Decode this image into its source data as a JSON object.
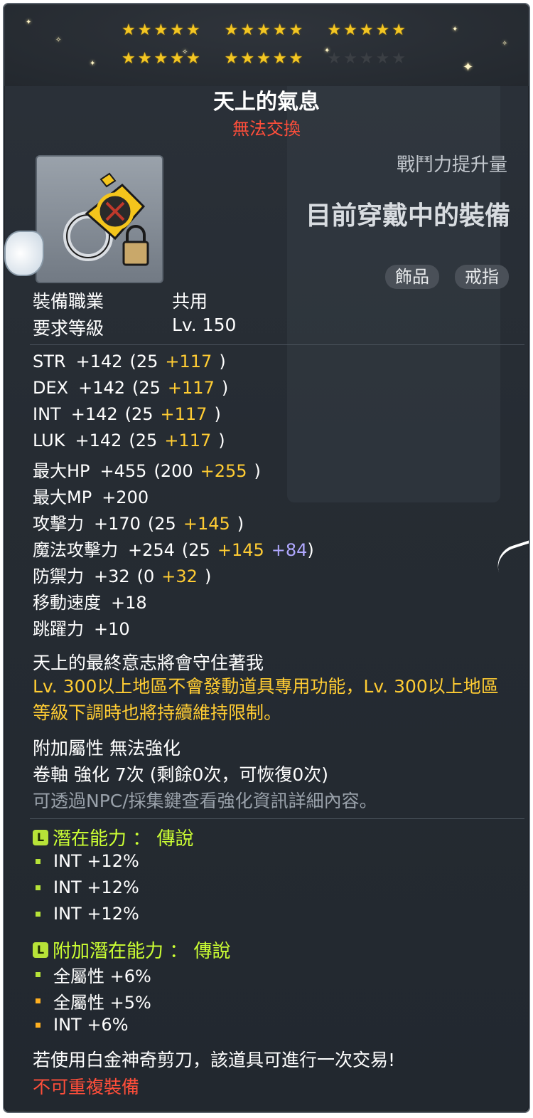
{
  "colors": {
    "accent_gold": "#ffcc33",
    "accent_blue": "#b0a8ff",
    "warning_red": "#ff4e3a",
    "potential_green": "#ccff33"
  },
  "stars": {
    "filled": 25,
    "total": 30
  },
  "item": {
    "name": "天上的氣息",
    "trade_status": "無法交換",
    "icon": "gold-ring-lock-icon"
  },
  "combat_power": {
    "label": "戰鬥力提升量",
    "value": "目前穿戴中的裝備"
  },
  "tags": {
    "category": "飾品",
    "type": "戒指"
  },
  "requirements": [
    {
      "label": "裝備職業",
      "value": "共用"
    },
    {
      "label": "要求等級",
      "value": "Lv. 150"
    }
  ],
  "stats": [
    {
      "name": "STR",
      "total": "+142",
      "open": "(25",
      "bonus": "+117",
      "extra": "",
      "close": ")"
    },
    {
      "name": "DEX",
      "total": "+142",
      "open": "(25",
      "bonus": "+117",
      "extra": "",
      "close": ")"
    },
    {
      "name": "INT",
      "total": "+142",
      "open": "(25",
      "bonus": "+117",
      "extra": "",
      "close": ")"
    },
    {
      "name": "LUK",
      "total": "+142",
      "open": "(25",
      "bonus": "+117",
      "extra": "",
      "close": ")"
    },
    {
      "name": "最大HP",
      "total": "+455",
      "open": "(200",
      "bonus": "+255",
      "extra": "",
      "close": ")"
    },
    {
      "name": "最大MP",
      "total": "+200",
      "open": "",
      "bonus": "",
      "extra": "",
      "close": ""
    },
    {
      "name": "攻擊力",
      "total": "+170",
      "open": "(25",
      "bonus": "+145",
      "extra": "",
      "close": ")"
    },
    {
      "name": "魔法攻擊力",
      "total": "+254",
      "open": "(25",
      "bonus": "+145",
      "extra": "+84",
      "close": ")"
    },
    {
      "name": "防禦力",
      "total": "+32",
      "open": "(0",
      "bonus": "+32",
      "extra": "",
      "close": ")"
    },
    {
      "name": "移動速度",
      "total": "+18",
      "open": "",
      "bonus": "",
      "extra": "",
      "close": ""
    },
    {
      "name": "跳躍力",
      "total": "+10",
      "open": "",
      "bonus": "",
      "extra": "",
      "close": ""
    }
  ],
  "flavor": "天上的最終意志將會守住著我",
  "warning": "Lv. 300以上地區不會發動道具專用功能，Lv. 300以上地區等級下調時也將持續維持限制。",
  "enhance": {
    "line1": "附加屬性 無法強化",
    "line2": "卷軸 強化 7次 (剩餘0次，可恢復0次)",
    "line3": "可透過NPC/採集鍵查看強化資訊詳細內容。"
  },
  "potential": {
    "header": "潛在能力 ： 傳說",
    "lines": [
      "INT +12%",
      "INT +12%",
      "INT +12%"
    ]
  },
  "additional_potential": {
    "header": "附加潛在能力 ： 傳說",
    "lines": [
      "全屬性 +6%",
      "全屬性 +5%",
      "INT +6%"
    ]
  },
  "footer": {
    "trade_note": "若使用白金神奇剪刀，該道具可進行一次交易!",
    "unique": "不可重複裝備"
  }
}
